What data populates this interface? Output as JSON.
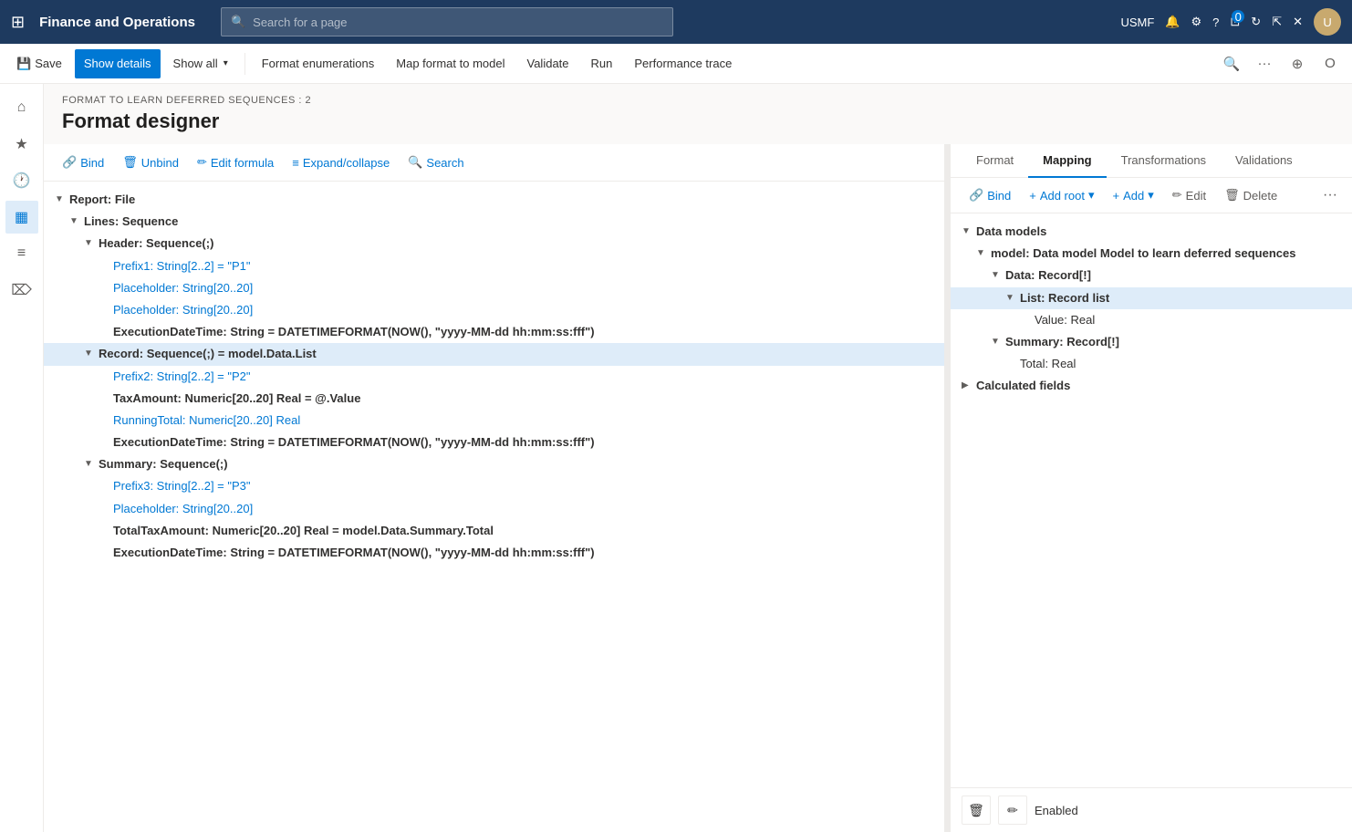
{
  "topNav": {
    "appTitle": "Finance and Operations",
    "searchPlaceholder": "Search for a page",
    "userCode": "USMF",
    "badgeCount": "0"
  },
  "toolbar": {
    "saveLabel": "Save",
    "showDetailsLabel": "Show details",
    "showAllLabel": "Show all",
    "formatEnumerationsLabel": "Format enumerations",
    "mapFormatToModelLabel": "Map format to model",
    "validateLabel": "Validate",
    "runLabel": "Run",
    "performanceTraceLabel": "Performance trace"
  },
  "breadcrumb": "FORMAT TO LEARN DEFERRED SEQUENCES : 2",
  "pageTitle": "Format designer",
  "treeToolbar": {
    "bindLabel": "Bind",
    "unbindLabel": "Unbind",
    "editFormulaLabel": "Edit formula",
    "expandCollapseLabel": "Expand/collapse",
    "searchLabel": "Search"
  },
  "treeNodes": [
    {
      "id": "n1",
      "indent": 0,
      "expand": "▼",
      "text": "Report: File",
      "bold": true,
      "blue": false,
      "selected": false
    },
    {
      "id": "n2",
      "indent": 1,
      "expand": "▼",
      "text": "Lines: Sequence",
      "bold": true,
      "blue": false,
      "selected": false
    },
    {
      "id": "n3",
      "indent": 2,
      "expand": "▼",
      "text": "Header: Sequence(;)",
      "bold": true,
      "blue": false,
      "selected": false
    },
    {
      "id": "n4",
      "indent": 3,
      "expand": "",
      "text": "Prefix1: String[2..2] = \"P1\"",
      "bold": false,
      "blue": true,
      "selected": false
    },
    {
      "id": "n5",
      "indent": 3,
      "expand": "",
      "text": "Placeholder: String[20..20]",
      "bold": false,
      "blue": true,
      "selected": false
    },
    {
      "id": "n6",
      "indent": 3,
      "expand": "",
      "text": "Placeholder: String[20..20]",
      "bold": false,
      "blue": true,
      "selected": false
    },
    {
      "id": "n7",
      "indent": 3,
      "expand": "",
      "text": "ExecutionDateTime: String = DATETIMEFORMAT(NOW(), \"yyyy-MM-dd hh:mm:ss:fff\")",
      "bold": true,
      "blue": false,
      "selected": false
    },
    {
      "id": "n8",
      "indent": 2,
      "expand": "▼",
      "text": "Record: Sequence(;) = model.Data.List",
      "bold": true,
      "blue": false,
      "selected": true
    },
    {
      "id": "n9",
      "indent": 3,
      "expand": "",
      "text": "Prefix2: String[2..2] = \"P2\"",
      "bold": false,
      "blue": true,
      "selected": false
    },
    {
      "id": "n10",
      "indent": 3,
      "expand": "",
      "text": "TaxAmount: Numeric[20..20] Real = @.Value",
      "bold": true,
      "blue": false,
      "selected": false
    },
    {
      "id": "n11",
      "indent": 3,
      "expand": "",
      "text": "RunningTotal: Numeric[20..20] Real",
      "bold": false,
      "blue": true,
      "selected": false
    },
    {
      "id": "n12",
      "indent": 3,
      "expand": "",
      "text": "ExecutionDateTime: String = DATETIMEFORMAT(NOW(), \"yyyy-MM-dd hh:mm:ss:fff\")",
      "bold": true,
      "blue": false,
      "selected": false
    },
    {
      "id": "n13",
      "indent": 2,
      "expand": "▼",
      "text": "Summary: Sequence(;)",
      "bold": true,
      "blue": false,
      "selected": false
    },
    {
      "id": "n14",
      "indent": 3,
      "expand": "",
      "text": "Prefix3: String[2..2] = \"P3\"",
      "bold": false,
      "blue": true,
      "selected": false
    },
    {
      "id": "n15",
      "indent": 3,
      "expand": "",
      "text": "Placeholder: String[20..20]",
      "bold": false,
      "blue": true,
      "selected": false
    },
    {
      "id": "n16",
      "indent": 3,
      "expand": "",
      "text": "TotalTaxAmount: Numeric[20..20] Real = model.Data.Summary.Total",
      "bold": true,
      "blue": false,
      "selected": false
    },
    {
      "id": "n17",
      "indent": 3,
      "expand": "",
      "text": "ExecutionDateTime: String = DATETIMEFORMAT(NOW(), \"yyyy-MM-dd hh:mm:ss:fff\")",
      "bold": true,
      "blue": false,
      "selected": false
    }
  ],
  "mappingTabs": [
    {
      "id": "format",
      "label": "Format",
      "active": false
    },
    {
      "id": "mapping",
      "label": "Mapping",
      "active": true
    },
    {
      "id": "transformations",
      "label": "Transformations",
      "active": false
    },
    {
      "id": "validations",
      "label": "Validations",
      "active": false
    }
  ],
  "mappingToolbar": {
    "bindLabel": "Bind",
    "addRootLabel": "Add root",
    "addLabel": "Add",
    "editLabel": "Edit",
    "deleteLabel": "Delete"
  },
  "mappingNodes": [
    {
      "id": "m1",
      "indent": 0,
      "expand": "▼",
      "text": "Data models",
      "bold": true,
      "selected": false
    },
    {
      "id": "m2",
      "indent": 1,
      "expand": "▼",
      "text": "model: Data model Model to learn deferred sequences",
      "bold": true,
      "selected": false
    },
    {
      "id": "m3",
      "indent": 2,
      "expand": "▼",
      "text": "Data: Record[!]",
      "bold": true,
      "selected": false
    },
    {
      "id": "m4",
      "indent": 3,
      "expand": "▼",
      "text": "List: Record list",
      "bold": true,
      "selected": true
    },
    {
      "id": "m5",
      "indent": 4,
      "expand": "",
      "text": "Value: Real",
      "bold": false,
      "selected": false
    },
    {
      "id": "m6",
      "indent": 2,
      "expand": "▼",
      "text": "Summary: Record[!]",
      "bold": true,
      "selected": false
    },
    {
      "id": "m7",
      "indent": 3,
      "expand": "",
      "text": "Total: Real",
      "bold": false,
      "selected": false
    },
    {
      "id": "m8",
      "indent": 0,
      "expand": "▶",
      "text": "Calculated fields",
      "bold": true,
      "selected": false
    }
  ],
  "footer": {
    "statusLabel": "Enabled"
  }
}
